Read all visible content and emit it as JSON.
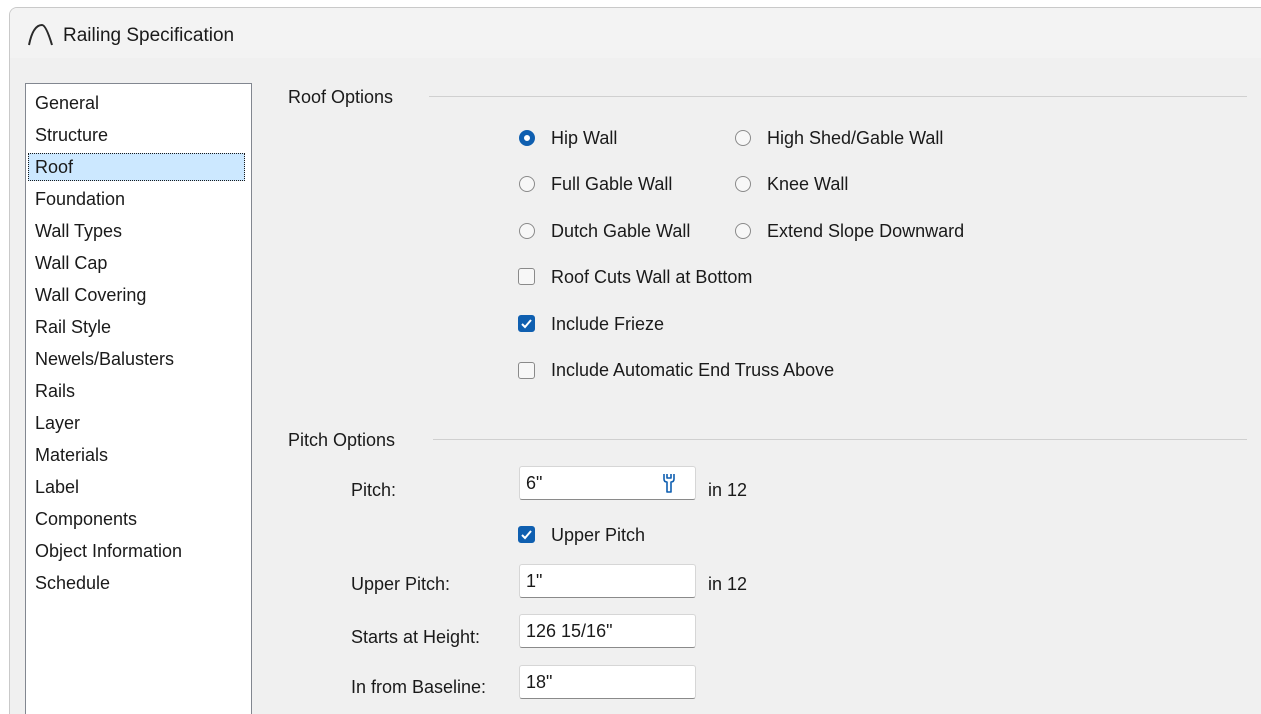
{
  "window": {
    "title": "Railing Specification"
  },
  "sidebar": {
    "items": [
      {
        "label": "General",
        "selected": false
      },
      {
        "label": "Structure",
        "selected": false
      },
      {
        "label": "Roof",
        "selected": true
      },
      {
        "label": "Foundation",
        "selected": false
      },
      {
        "label": "Wall Types",
        "selected": false
      },
      {
        "label": "Wall Cap",
        "selected": false
      },
      {
        "label": "Wall Covering",
        "selected": false
      },
      {
        "label": "Rail Style",
        "selected": false
      },
      {
        "label": "Newels/Balusters",
        "selected": false
      },
      {
        "label": "Rails",
        "selected": false
      },
      {
        "label": "Layer",
        "selected": false
      },
      {
        "label": "Materials",
        "selected": false
      },
      {
        "label": "Label",
        "selected": false
      },
      {
        "label": "Components",
        "selected": false
      },
      {
        "label": "Object Information",
        "selected": false
      },
      {
        "label": "Schedule",
        "selected": false
      }
    ]
  },
  "roof_options": {
    "title": "Roof Options",
    "radios": [
      {
        "label": "Hip Wall",
        "checked": true
      },
      {
        "label": "High Shed/Gable Wall",
        "checked": false
      },
      {
        "label": "Full Gable Wall",
        "checked": false
      },
      {
        "label": "Knee Wall",
        "checked": false
      },
      {
        "label": "Dutch Gable Wall",
        "checked": false
      },
      {
        "label": "Extend Slope Downward",
        "checked": false
      }
    ],
    "checkboxes": [
      {
        "label": "Roof Cuts Wall at Bottom",
        "checked": false
      },
      {
        "label": "Include Frieze",
        "checked": true
      },
      {
        "label": "Include Automatic End Truss Above",
        "checked": false
      }
    ]
  },
  "pitch_options": {
    "title": "Pitch Options",
    "pitch_label": "Pitch:",
    "pitch_value": "6\"",
    "pitch_suffix": "in 12",
    "upper_pitch_checkbox": {
      "label": "Upper Pitch",
      "checked": true
    },
    "upper_pitch_label": "Upper Pitch:",
    "upper_pitch_value": "1\"",
    "upper_pitch_suffix": "in 12",
    "starts_at_height_label": "Starts at Height:",
    "starts_at_height_value": "126 15/16\"",
    "in_from_baseline_label": "In from Baseline:",
    "in_from_baseline_value": "18\""
  },
  "icons": [
    "railing-app-icon",
    "wrench-icon"
  ],
  "colors": {
    "accent": "#0f5fb0",
    "selection": "#cce8ff",
    "window_bg": "#f0f0f0"
  }
}
